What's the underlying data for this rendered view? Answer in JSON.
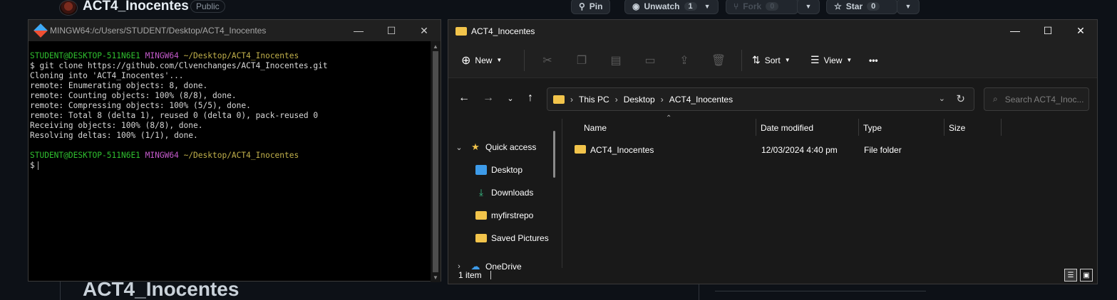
{
  "github": {
    "repo_name": "ACT4_Inocentes",
    "visibility": "Public",
    "pin_label": "Pin",
    "watch_label": "Unwatch",
    "watch_count": "1",
    "fork_label": "Fork",
    "fork_count": "0",
    "star_label": "Star",
    "star_count": "0",
    "bottom_title": "ACT4_Inocentes"
  },
  "terminal": {
    "title": "MINGW64:/c/Users/STUDENT/Desktop/ACT4_Inocentes",
    "prompt_user": "STUDENT@DESKTOP-511N6E1",
    "prompt_shell": "MINGW64",
    "prompt_path": "~/Desktop/ACT4_Inocentes",
    "command": "$ git clone https://github.com/Clvenchanges/ACT4_Inocentes.git",
    "output": [
      "Cloning into 'ACT4_Inocentes'...",
      "remote: Enumerating objects: 8, done.",
      "remote: Counting objects: 100% (8/8), done.",
      "remote: Compressing objects: 100% (5/5), done.",
      "remote: Total 8 (delta 1), reused 0 (delta 0), pack-reused 0",
      "Receiving objects: 100% (8/8), done.",
      "Resolving deltas: 100% (1/1), done."
    ],
    "prompt_symbol": "$"
  },
  "explorer": {
    "title": "ACT4_Inocentes",
    "toolbar": {
      "new_label": "New",
      "sort_label": "Sort",
      "view_label": "View",
      "more_label": "•••"
    },
    "breadcrumb": [
      "This PC",
      "Desktop",
      "ACT4_Inocentes"
    ],
    "search_placeholder": "Search ACT4_Inoc...",
    "sidebar": [
      {
        "label": "Quick access"
      },
      {
        "label": "Desktop"
      },
      {
        "label": "Downloads"
      },
      {
        "label": "myfirstrepo"
      },
      {
        "label": "Saved Pictures"
      },
      {
        "label": "OneDrive"
      }
    ],
    "columns": [
      "Name",
      "Date modified",
      "Type",
      "Size"
    ],
    "rows": [
      {
        "name": "ACT4_Inocentes",
        "date": "12/03/2024 4:40 pm",
        "type": "File folder",
        "size": ""
      }
    ],
    "status": "1 item"
  }
}
